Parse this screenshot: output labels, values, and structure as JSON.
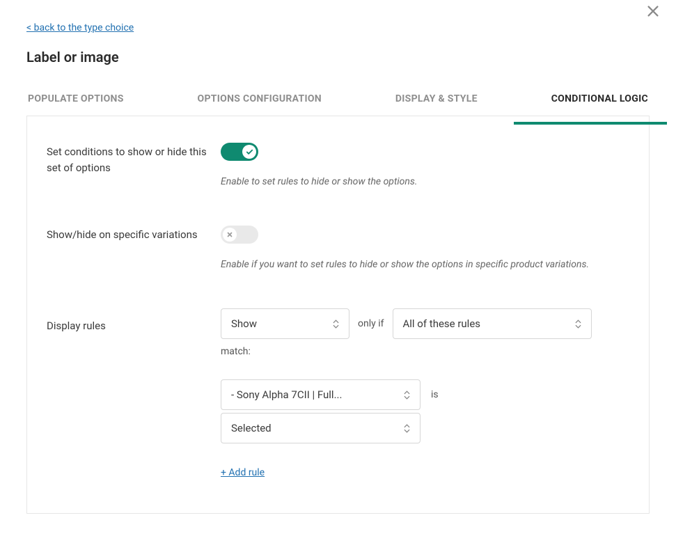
{
  "back_link": "< back to the type choice",
  "title": "Label or image",
  "tabs": {
    "populate": "POPULATE OPTIONS",
    "config": "OPTIONS CONFIGURATION",
    "display": "DISPLAY & STYLE",
    "conditional": "CONDITIONAL LOGIC"
  },
  "fields": {
    "conditions": {
      "label": "Set conditions to show or hide this set of options",
      "hint": "Enable to set rules to hide or show the options.",
      "enabled": true
    },
    "variations": {
      "label": "Show/hide on specific variations",
      "hint": "Enable if you want to set rules to hide or show the options in specific product variations.",
      "enabled": false
    },
    "rules": {
      "label": "Display rules",
      "action": "Show",
      "only_if": "only if",
      "scope": "All of these rules",
      "match": "match:",
      "subject": "- Sony Alpha 7CII | Full...",
      "is": "is",
      "state": "Selected",
      "add_rule": "+ Add rule"
    }
  }
}
